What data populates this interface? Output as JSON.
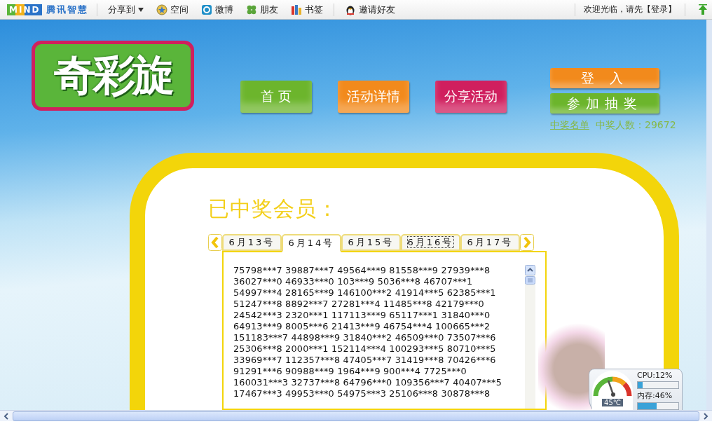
{
  "toolbar": {
    "brand_mark": "MIND",
    "brand_name": "腾讯智慧",
    "share": "分享到",
    "items": [
      {
        "label": "空间",
        "kind": "space"
      },
      {
        "label": "微博",
        "kind": "weibo"
      },
      {
        "label": "朋友",
        "kind": "friends"
      },
      {
        "label": "书签",
        "kind": "bookmark"
      }
    ],
    "invite": "邀请好友",
    "welcome": "欢迎光临，请先【登录】"
  },
  "header": {
    "logo": "奇彩旋",
    "nav": [
      {
        "label": "首 页",
        "color": "#6cb52c"
      },
      {
        "label": "活动详情",
        "color": "#f28a1c"
      },
      {
        "label": "分享活动",
        "color": "#d01f5e"
      }
    ],
    "actions": [
      {
        "label": "登 入",
        "color": "#f28a1c"
      },
      {
        "label": "参加抽奖",
        "color": "#6cb52c"
      }
    ],
    "winners_link": "中奖名单",
    "winner_count": "中奖人数：29672"
  },
  "winners": {
    "title": "已中奖会员：",
    "tabs": [
      {
        "label": "6月13号",
        "selected": false,
        "focused": false
      },
      {
        "label": "6月14号",
        "selected": true,
        "focused": false
      },
      {
        "label": "6月15号",
        "selected": false,
        "focused": false
      },
      {
        "label": "6月16号",
        "selected": false,
        "focused": true
      },
      {
        "label": "6月17号",
        "selected": false,
        "focused": false
      }
    ],
    "list": [
      "75798***7 39887***7 49564***9 81558***9 27939***8",
      "36027***0 46933***0 103***9 5036***8 46707***1",
      "54997***4 28165***9 146100***2 41914***5 62385***1",
      "51247***8 8892***7 27281***4 11485***8 42179***0",
      "24542***3 2320***1 117113***9 65117***1 31840***0",
      "64913***9 8005***6 21413***9 46754***4 100665***2",
      "151183***7 44898***9 31840***2 46509***0 73507***6",
      "25306***8 2000***1 152114***4 100293***5 80710***5",
      "33969***7 112357***8 47405***7 31419***8 70426***6",
      "91291***6 90988***9 1964***9 900***4 7725***0",
      "160031***3 32737***8 64796***0 109356***7 40407***5",
      "17467***3 49953***0 54975***3 25106***8 30878***8"
    ]
  },
  "system_monitor": {
    "temperature": "45℃",
    "meters": [
      {
        "label": "CPU:12%",
        "level": 0.12
      },
      {
        "label": "内存:46%",
        "level": 0.46
      }
    ]
  }
}
